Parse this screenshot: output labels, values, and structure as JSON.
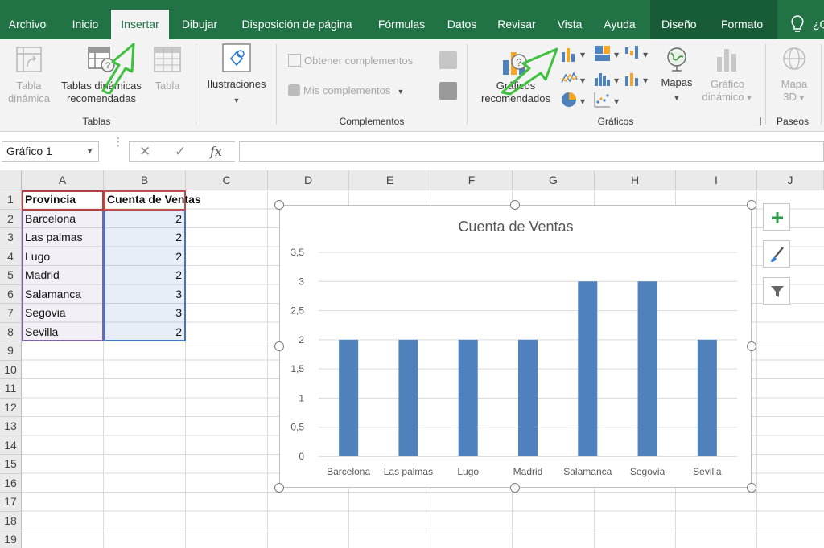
{
  "menu": {
    "tabs": [
      "Archivo",
      "Inicio",
      "Insertar",
      "Dibujar",
      "Disposición de página",
      "Fórmulas",
      "Datos",
      "Revisar",
      "Vista",
      "Ayuda"
    ],
    "active_tab": "Insertar",
    "context_tabs": [
      "Diseño",
      "Formato"
    ],
    "tell_me": "¿Q"
  },
  "ribbon": {
    "tablas": {
      "label": "Tablas",
      "tabla_dinamica": [
        "Tabla",
        "dinámica"
      ],
      "tablas_recomendadas": [
        "Tablas dinámicas",
        "recomendadas"
      ],
      "tabla": "Tabla"
    },
    "ilustraciones": {
      "label": "Ilustraciones"
    },
    "complementos": {
      "label": "Complementos",
      "obtener": "Obtener complementos",
      "mis": "Mis complementos"
    },
    "graficos": {
      "label": "Gráficos",
      "recomendados": [
        "Gráficos",
        "recomendados"
      ],
      "mapas": "Mapas",
      "grafico_dinamico": [
        "Gráfico",
        "dinámico"
      ]
    },
    "paseos": {
      "label": "Paseos",
      "mapa3d": [
        "Mapa",
        "3D"
      ]
    }
  },
  "formula_bar": {
    "name_box": "Gráfico 1",
    "fx": "fx",
    "formula": ""
  },
  "sheet": {
    "columns": [
      "A",
      "B",
      "C",
      "D",
      "E",
      "F",
      "G",
      "H",
      "I",
      "J"
    ],
    "rows": [
      "1",
      "2",
      "3",
      "4",
      "5",
      "6",
      "7",
      "8",
      "9",
      "10",
      "11",
      "12",
      "13",
      "14",
      "15",
      "16",
      "17",
      "18",
      "19"
    ],
    "header": {
      "provincia": "Provincia",
      "cuenta": "Cuenta de Ventas"
    },
    "data": [
      {
        "provincia": "Barcelona",
        "cuenta": "2"
      },
      {
        "provincia": "Las palmas",
        "cuenta": "2"
      },
      {
        "provincia": "Lugo",
        "cuenta": "2"
      },
      {
        "provincia": "Madrid",
        "cuenta": "2"
      },
      {
        "provincia": "Salamanca",
        "cuenta": "3"
      },
      {
        "provincia": "Segovia",
        "cuenta": "3"
      },
      {
        "provincia": "Sevilla",
        "cuenta": "2"
      }
    ]
  },
  "chart_data": {
    "type": "bar",
    "title": "Cuenta de Ventas",
    "categories": [
      "Barcelona",
      "Las palmas",
      "Lugo",
      "Madrid",
      "Salamanca",
      "Segovia",
      "Sevilla"
    ],
    "values": [
      2,
      2,
      2,
      2,
      3,
      3,
      2
    ],
    "ylim": [
      0,
      3.5
    ],
    "yticks": [
      "0",
      "0,5",
      "1",
      "1,5",
      "2",
      "2,5",
      "3",
      "3,5"
    ],
    "grid": true,
    "legend": "none",
    "bar_color": "#4f81bd"
  },
  "colors": {
    "excel_green": "#217346",
    "context_green": "#185c37",
    "annotation_arrow": "#3ec13e"
  }
}
